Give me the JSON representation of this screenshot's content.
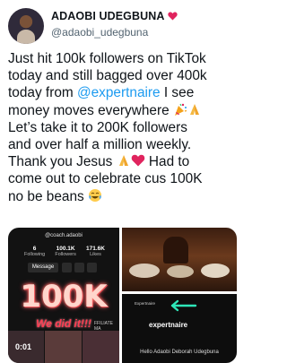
{
  "author": {
    "display_name": "ADAOBI UDEGBUNA",
    "handle": "@adaobi_udegbuna"
  },
  "tweet": {
    "lines": [
      "Just hit 100k followers on TikTok",
      "today and still bagged over 400k",
      "today from ",
      "money moves everywhere ",
      "Let’s take it to 200K followers",
      "and over half a million weekly.",
      "Thank you Jesus ",
      "come out to celebrate cus 100K",
      "no be beans "
    ],
    "mention": "@expertnaire",
    "line3_tail": " I see",
    "line7_tail": " Had to"
  },
  "media": {
    "tiktok": {
      "handle": "@coach.adaobi",
      "stats": [
        {
          "value": "6",
          "label": "Following"
        },
        {
          "value": "100.1K",
          "label": "Followers"
        },
        {
          "value": "171.6K",
          "label": "Likes"
        }
      ],
      "message_label": "Message",
      "big_text": "100K",
      "celebration": "We did it!!!",
      "affiliate": "FFILIATE MA",
      "timer": "0:01"
    },
    "email": {
      "sender": "Expertnaire",
      "brand": "expertnaire",
      "greeting": "Hello Adaobi Deborah Udegbuna"
    }
  },
  "colors": {
    "mention": "#1d9bf0",
    "handle": "#536471",
    "heart": "#e0245e",
    "arrow": "#2ee6b8"
  }
}
